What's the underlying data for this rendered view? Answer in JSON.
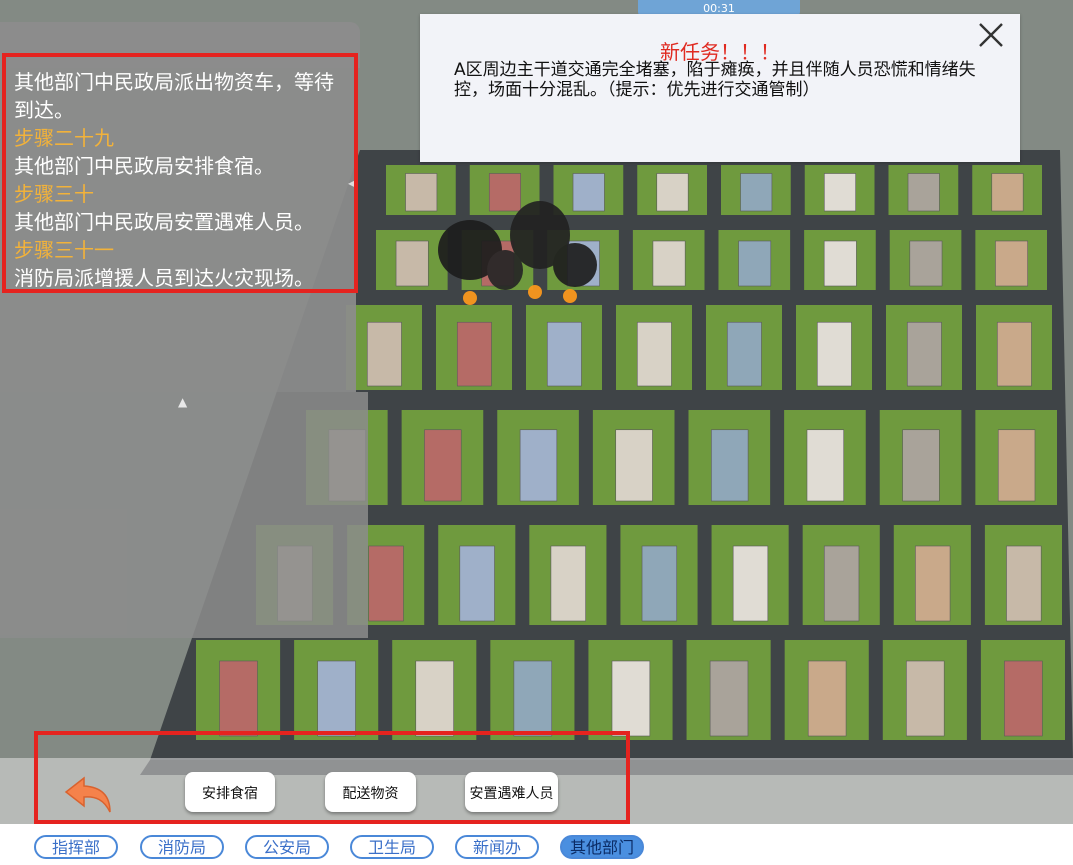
{
  "timer": "00:31",
  "log": {
    "lines": [
      {
        "text": "其他部门中民政局派出物资车，等待到达。",
        "type": "text"
      },
      {
        "text": "步骤二十九",
        "type": "step"
      },
      {
        "text": "其他部门中民政局安排食宿。",
        "type": "text"
      },
      {
        "text": "步骤三十",
        "type": "step"
      },
      {
        "text": "其他部门中民政局安置遇难人员。",
        "type": "text"
      },
      {
        "text": "步骤三十一",
        "type": "step"
      },
      {
        "text": "消防局派增援人员到达火灾现场。",
        "type": "text"
      }
    ]
  },
  "task": {
    "title": "新任务！！！",
    "body": "A区周边主干道交通完全堵塞，陷于瘫痪，并且伴随人员恐慌和情绪失控，场面十分混乱。（提示：优先进行交通管制）",
    "close_icon": "close-icon"
  },
  "actions": {
    "back_icon": "back-arrow-icon",
    "buttons": [
      "安排食宿",
      "配送物资",
      "安置遇难人员"
    ]
  },
  "departments": {
    "tabs": [
      "指挥部",
      "消防局",
      "公安局",
      "卫生局",
      "新闻办",
      "其他部门"
    ],
    "active": "其他部门"
  },
  "colors": {
    "highlight_border": "#e5231f",
    "step_text": "#f2b23a",
    "task_title": "#e02a21",
    "tab_border": "#4a88d8",
    "tab_active_bg": "#4a8fe0"
  }
}
